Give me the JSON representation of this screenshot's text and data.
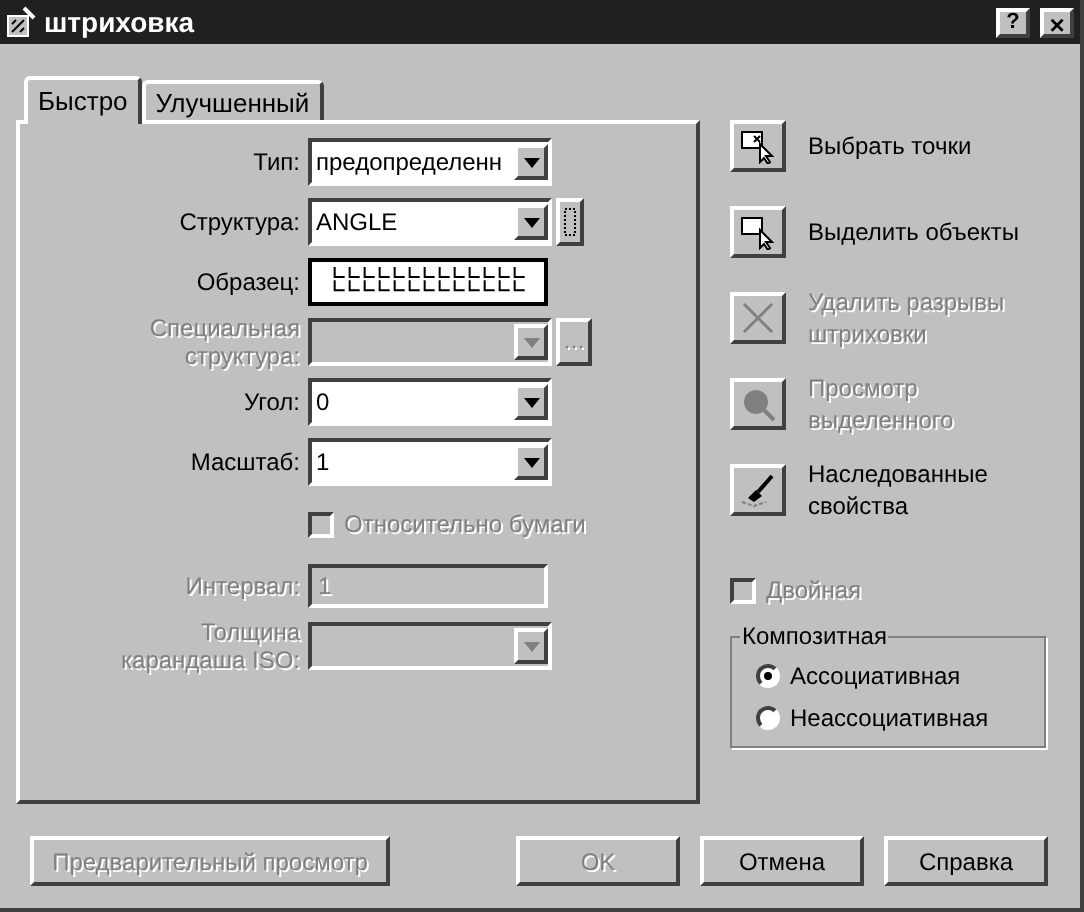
{
  "window": {
    "title": "штриховка",
    "help_button": "?",
    "close_button": "×"
  },
  "tabs": [
    {
      "label": "Быстро",
      "selected": true
    },
    {
      "label": "Улучшенный",
      "selected": false
    }
  ],
  "fields": [
    {
      "kind": "combo",
      "label": "Тип:",
      "value": "предопределенн",
      "disabled": false
    },
    {
      "kind": "combo",
      "label": "Структура:",
      "value": "ANGLE",
      "disabled": false,
      "pattern_button": true
    },
    {
      "kind": "swatch",
      "label": "Образец:",
      "disabled": false
    },
    {
      "kind": "combo",
      "label": "Специальная структура:",
      "disabled": true,
      "side_button": "…"
    },
    {
      "kind": "combo",
      "label": "Угол:",
      "value": "0",
      "disabled": false
    },
    {
      "kind": "combo",
      "label": "Масштаб:",
      "value": "1",
      "disabled": false
    },
    {
      "kind": "checkbox",
      "label": "Относительно бумаги",
      "checked": false,
      "disabled": true
    },
    {
      "kind": "text",
      "label": "Интервал:",
      "value": "1",
      "disabled": true
    },
    {
      "kind": "combo",
      "label": "Толщина карандаша ISO:",
      "disabled": true
    }
  ],
  "actions": [
    {
      "kind": "pick",
      "label": "Выбрать точки",
      "disabled": false
    },
    {
      "kind": "select",
      "label": "Выделить объекты",
      "disabled": false
    },
    {
      "kind": "remove",
      "label": "Удалить разрывы штриховки",
      "disabled": true
    },
    {
      "kind": "view",
      "label": "Просмотр выделенного",
      "disabled": true
    },
    {
      "kind": "inherit",
      "label": "Наследованные свойства",
      "disabled": false
    }
  ],
  "double": {
    "label": "Двойная",
    "checked": false,
    "disabled": true
  },
  "composite": {
    "title": "Композитная",
    "options": [
      {
        "label": "Ассоциативная",
        "selected": true
      },
      {
        "label": "Неассоциативная",
        "selected": false
      }
    ]
  },
  "buttons": [
    {
      "label": "Предварительный просмотр",
      "disabled": true
    },
    {
      "label": "OK",
      "disabled": true
    },
    {
      "label": "Отмена",
      "disabled": false
    },
    {
      "label": "Справка",
      "disabled": false
    }
  ]
}
